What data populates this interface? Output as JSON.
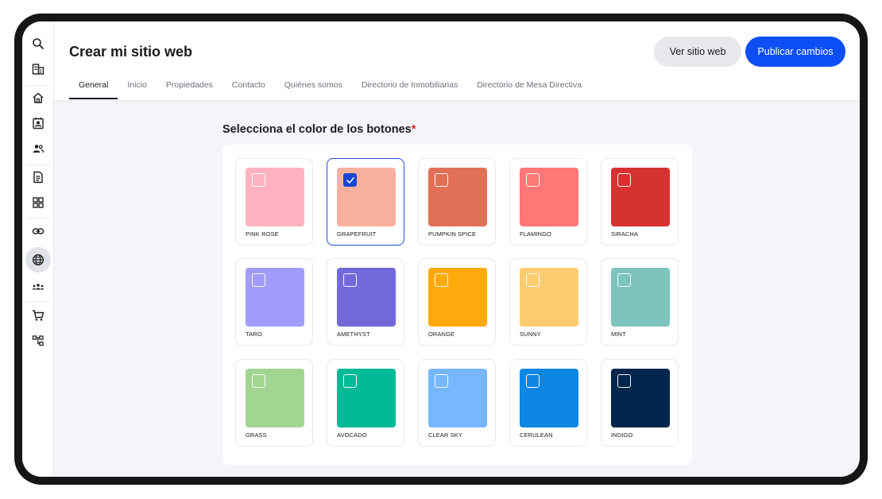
{
  "header": {
    "title": "Crear mi sitio web",
    "view_site_label": "Ver sitio web",
    "publish_label": "Publicar cambios"
  },
  "tabs": [
    {
      "label": "General",
      "active": true
    },
    {
      "label": "Inicio",
      "active": false
    },
    {
      "label": "Propiedades",
      "active": false
    },
    {
      "label": "Contacto",
      "active": false
    },
    {
      "label": "Quiénes somos",
      "active": false
    },
    {
      "label": "Directorio de Inmobiliarias",
      "active": false
    },
    {
      "label": "Directorio de Mesa Directiva",
      "active": false
    }
  ],
  "sidebar": {
    "items": [
      {
        "icon": "search-icon"
      },
      {
        "icon": "building-icon"
      },
      {
        "icon": "home-icon"
      },
      {
        "icon": "contact-card-icon"
      },
      {
        "icon": "users-icon"
      },
      {
        "icon": "document-icon"
      },
      {
        "icon": "grid-icon"
      },
      {
        "icon": "link-icon"
      },
      {
        "icon": "globe-icon",
        "active": true
      },
      {
        "icon": "team-icon"
      },
      {
        "icon": "cart-icon"
      },
      {
        "icon": "sitemap-icon"
      }
    ]
  },
  "section": {
    "title": "Selecciona el color de los botones",
    "required_mark": "*"
  },
  "colors": [
    {
      "name": "PINK ROSE",
      "hex": "#FFB3C1",
      "selected": false
    },
    {
      "name": "GRAPEFRUIT",
      "hex": "#F8B1A0",
      "selected": true
    },
    {
      "name": "PUMPKIN SPICE",
      "hex": "#E07157",
      "selected": false
    },
    {
      "name": "FLAMINGO",
      "hex": "#FF7877",
      "selected": false
    },
    {
      "name": "SIRACHA",
      "hex": "#D63231",
      "selected": false
    },
    {
      "name": "TARO",
      "hex": "#A19CFA",
      "selected": false
    },
    {
      "name": "AMETHYST",
      "hex": "#7469DA",
      "selected": false
    },
    {
      "name": "ORANGE",
      "hex": "#FFA90D",
      "selected": false
    },
    {
      "name": "SUNNY",
      "hex": "#FFCD71",
      "selected": false
    },
    {
      "name": "MINT",
      "hex": "#7DC5BC",
      "selected": false
    },
    {
      "name": "GRASS",
      "hex": "#A3D592",
      "selected": false
    },
    {
      "name": "AVOCADO",
      "hex": "#00B996",
      "selected": false
    },
    {
      "name": "CLEAR SKY",
      "hex": "#77B7FF",
      "selected": false
    },
    {
      "name": "CERULEAN",
      "hex": "#0E86E4",
      "selected": false
    },
    {
      "name": "INDIGO",
      "hex": "#00264B",
      "selected": false
    }
  ]
}
